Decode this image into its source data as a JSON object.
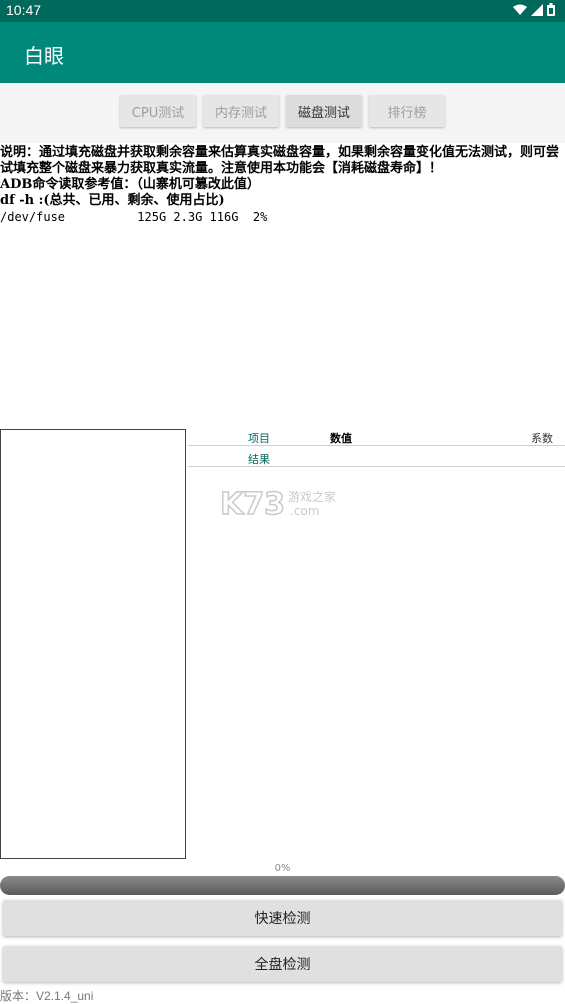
{
  "status_bar": {
    "time": "10:47",
    "icons": [
      "wifi-icon",
      "signal-icon",
      "battery-icon"
    ]
  },
  "app": {
    "title": "白眼"
  },
  "tabs": [
    {
      "label": "CPU测试",
      "active": false
    },
    {
      "label": "内存测试",
      "active": false
    },
    {
      "label": "磁盘测试",
      "active": true
    },
    {
      "label": "排行榜",
      "active": false
    }
  ],
  "description": {
    "line1": "说明：通过填充磁盘并获取剩余容量来估算真实磁盘容量，如果剩余容量变化值无法测试，则可尝试填充整个磁盘来暴力获取真实流量。注意使用本功能会【消耗磁盘寿命】！",
    "line2": "ADB命令读取参考值：（山寨机可篡改此值）",
    "line3": "df -h :(总共、已用、剩余、使用占比)",
    "line4": "/dev/fuse          125G 2.3G 116G  2%"
  },
  "table": {
    "header": {
      "item": "项目",
      "value": "数值",
      "coef": "系数"
    },
    "rows": [
      {
        "item": "结果"
      }
    ]
  },
  "progress": {
    "label": "0%",
    "value": 0
  },
  "buttons": {
    "quick": "快速检测",
    "full": "全盘检测"
  },
  "version": "版本：V2.1.4_uni",
  "colors": {
    "status_bar": "#00695c",
    "app_bar": "#00897b"
  }
}
